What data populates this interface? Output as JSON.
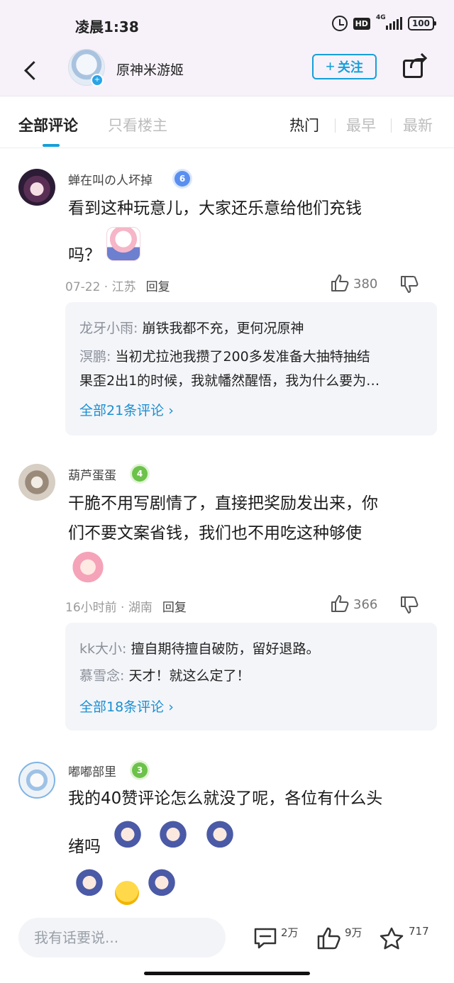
{
  "status_bar": {
    "time": "凌晨1:38",
    "hd": "HD",
    "network": "4G",
    "battery": "100"
  },
  "header": {
    "account_name": "原神米游姬",
    "follow_label": "关注",
    "avatar_badge": "+",
    "icons": {
      "back": "back-arrow-icon",
      "share": "share-icon"
    }
  },
  "tabs": {
    "all": "全部评论",
    "owner_only": "只看楼主",
    "sort_hot": "热门",
    "sort_earliest": "最早",
    "sort_newest": "最新"
  },
  "comments": [
    {
      "username": "蝉在叫の人坏掉",
      "level": "6",
      "text_line1": "看到这种玩意儿，大家还乐意给他们充钱",
      "text_line2": "吗？",
      "meta": "07-22 · 江苏",
      "reply_label": "回复",
      "likes": "380",
      "replies": [
        {
          "author": "龙牙小雨:",
          "text": "崩铁我都不充，更何况原神"
        },
        {
          "author": "溟鹏:",
          "text": "当初尤拉池我攒了200多发准备大抽特抽结",
          "text2": "果歪2出1的时候，我就幡然醒悟，我为什么要为…"
        }
      ],
      "more": "全部21条评论 ›"
    },
    {
      "username": "葫芦蛋蛋",
      "level": "4",
      "text_line1": "干脆不用写剧情了，直接把奖励发出来，你",
      "text_line2": "们不要文案省钱，我们也不用吃这种够使",
      "meta": "16小时前 · 湖南",
      "reply_label": "回复",
      "likes": "366",
      "replies": [
        {
          "author": "kk大小:",
          "text": "擅自期待擅自破防，留好退路。"
        },
        {
          "author": "慕雪念:",
          "text": "天才！就这么定了！"
        }
      ],
      "more": "全部18条评论 ›"
    },
    {
      "username": "嘟嘟部里",
      "level": "3",
      "text_line1": "我的40赞评论怎么就没了呢，各位有什么头",
      "text_line2": "绪吗"
    }
  ],
  "bottom_bar": {
    "input_placeholder": "我有话要说...",
    "comment_count": "2万",
    "like_count": "9万",
    "favorite_count": "717"
  },
  "colors": {
    "accent": "#16a0d9",
    "header_bg": "#f7f1fa",
    "reply_bg": "#f4f5f9"
  }
}
